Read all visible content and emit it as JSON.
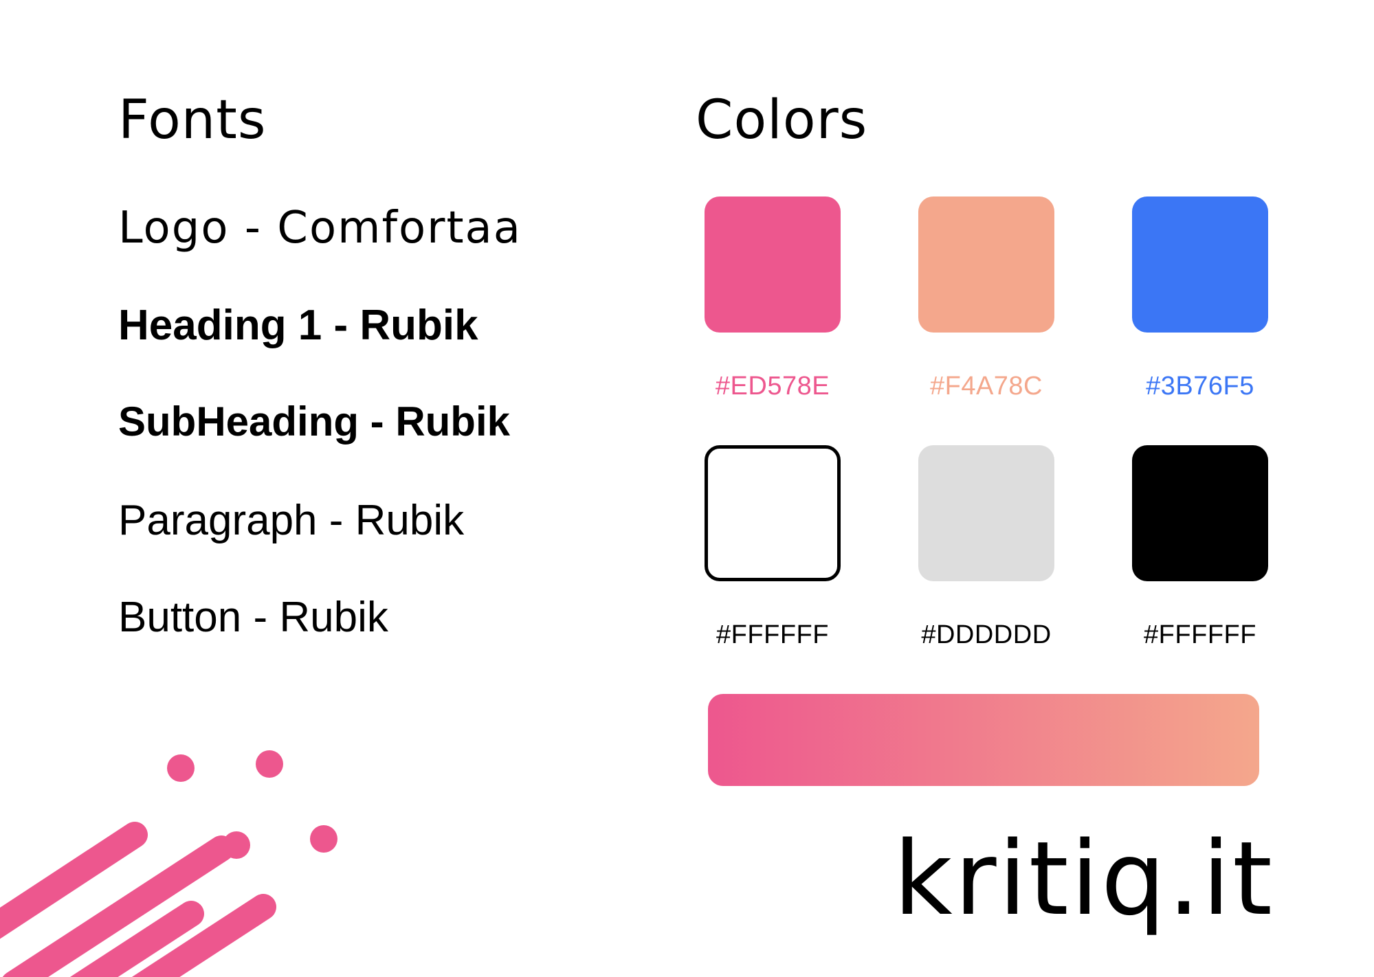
{
  "fonts": {
    "title": "Fonts",
    "items": [
      "Logo - Comfortaa",
      "Heading 1 - Rubik",
      "SubHeading - Rubik",
      "Paragraph - Rubik",
      "Button - Rubik"
    ]
  },
  "colors": {
    "title": "Colors",
    "swatches": [
      {
        "label": "#ED578E",
        "fill": "#ED578E",
        "label_color": "#ED578E"
      },
      {
        "label": "#F4A78C",
        "fill": "#F4A78C",
        "label_color": "#F4A78C"
      },
      {
        "label": "#3B76F5",
        "fill": "#3B76F5",
        "label_color": "#3B76F5"
      },
      {
        "label": "#FFFFFF",
        "fill": "#FFFFFF",
        "label_color": "#000000",
        "outlined": true
      },
      {
        "label": "#DDDDDD",
        "fill": "#DDDDDD",
        "label_color": "#000000"
      },
      {
        "label": "#FFFFFF",
        "fill": "#000000",
        "label_color": "#000000"
      }
    ],
    "gradient": {
      "from": "#ED578E",
      "to": "#F4A78C"
    }
  },
  "brand": {
    "wordmark": "kritiq.it",
    "accent": "#ED578E"
  }
}
